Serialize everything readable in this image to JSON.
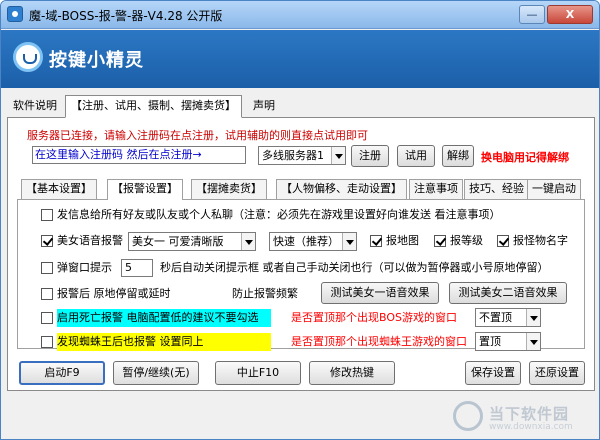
{
  "window": {
    "title": "魔-域-BOSS-报-警-器-V4.28 公开版",
    "min_label": "—",
    "close_label": "X"
  },
  "header": {
    "logo_text": "按键小精灵"
  },
  "main_tabs": [
    "软件说明",
    "【注册、试用、摄制、摆摊卖货】",
    "声明"
  ],
  "register": {
    "info": "服务器已连接，请输入注册码在点注册，试用辅助的则直接点试用即可",
    "code_input": "在这里输入注册码 然后在点注册→",
    "server": "多线服务器1",
    "register_btn": "注册",
    "trial_btn": "试用",
    "unbind_btn": "解绑",
    "notice": "换电脑用记得解绑"
  },
  "sub_tabs": [
    "【基本设置】",
    "【报警设置】",
    "【摆摊卖货】",
    "【人物偏移、走动设置】",
    "注意事项",
    "技巧、经验",
    "一键启动"
  ],
  "settings": {
    "row1": "发信息给所有好友或队友或个人私聊（注意：必须先在游戏里设置好向谁发送 看注意事项）",
    "voice_label": "美女语音报警",
    "voice_select": "美女一 可爱清晰版",
    "speed_select": "快速（推荐）",
    "map_label": "报地图",
    "level_label": "报等级",
    "monster_label": "报怪物名字",
    "popup_label": "弹窗口提示",
    "popup_seconds": "5",
    "popup_desc": "秒后自动关闭提示框 或者自己手动关闭也行（可以做为暂停器或小号原地停留）",
    "stop_label": "报警后 原地停留或延时",
    "freq_label": "防止报警频繁",
    "test_voice1": "测试美女一语音效果",
    "test_voice2": "测试美女二语音效果",
    "death_label": "启用死亡报警 电脑配置低的建议不要勾选",
    "bos_window_label": "是否置顶那个出现BOS游戏的窗口",
    "bos_window_select": "不置顶",
    "spider_label": "发现蜘蛛王后也报警 设置同上",
    "spider_window_label": "是否置顶那个出现蜘蛛王游戏的窗口",
    "spider_window_select": "置顶"
  },
  "bottom": {
    "start": "启动F9",
    "pause": "暂停/继续(无)",
    "stop": "中止F10",
    "hotkey": "修改热键",
    "save": "保存设置",
    "restore": "还原设置"
  },
  "watermark": {
    "text": "当下软件园",
    "sub": "www.downxia.com"
  },
  "colors": {
    "header_blue": "#1b5fa8",
    "alert_red": "#ff0000",
    "highlight_cyan": "#00ffff",
    "highlight_yellow": "#ffff00"
  }
}
